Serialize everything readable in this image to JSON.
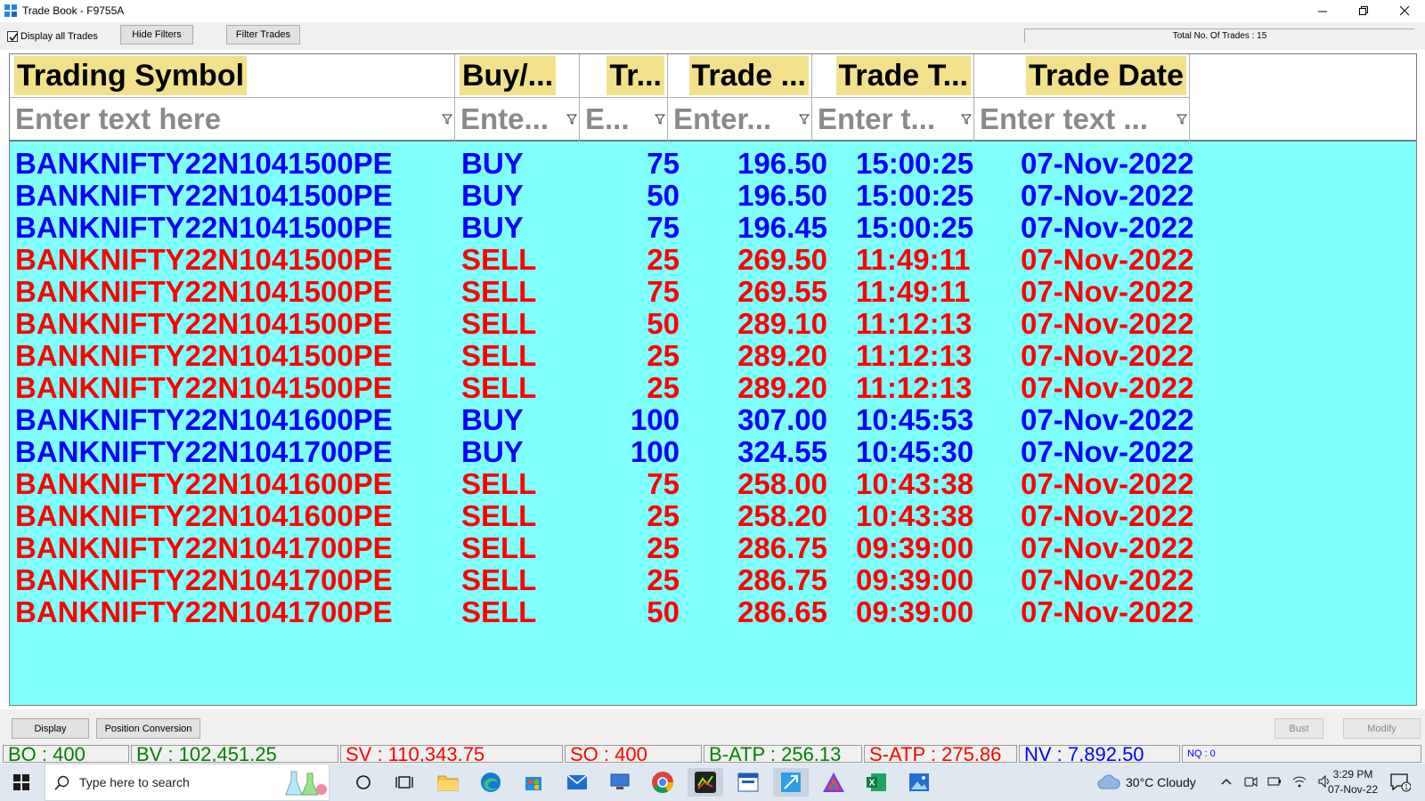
{
  "window": {
    "title": "Trade Book - F9755A"
  },
  "toolbar": {
    "display_all_label": "Display all Trades",
    "display_all_checked": true,
    "hide_filters_label": "Hide Filters",
    "filter_trades_label": "Filter Trades",
    "total_trades_text": "Total No. Of Trades : 15"
  },
  "grid": {
    "columns": [
      "Trading Symbol",
      "Buy/...",
      "Tr...",
      "Trade ...",
      "Trade T...",
      "Trade Date"
    ],
    "filters": [
      "Enter text here",
      "Ente...",
      "E...",
      "Enter...",
      "Enter t...",
      "Enter text ..."
    ],
    "colors": {
      "buy": "#0000ff",
      "sell": "#ff0000",
      "background": "#80ffff",
      "header_highlight": "#f2e18a"
    },
    "rows": [
      {
        "symbol": "BANKNIFTY22N1041500PE",
        "side": "BUY",
        "qty": "75",
        "price": "196.50",
        "time": "15:00:25",
        "date": "07-Nov-2022"
      },
      {
        "symbol": "BANKNIFTY22N1041500PE",
        "side": "BUY",
        "qty": "50",
        "price": "196.50",
        "time": "15:00:25",
        "date": "07-Nov-2022"
      },
      {
        "symbol": "BANKNIFTY22N1041500PE",
        "side": "BUY",
        "qty": "75",
        "price": "196.45",
        "time": "15:00:25",
        "date": "07-Nov-2022"
      },
      {
        "symbol": "BANKNIFTY22N1041500PE",
        "side": "SELL",
        "qty": "25",
        "price": "269.50",
        "time": "11:49:11",
        "date": "07-Nov-2022"
      },
      {
        "symbol": "BANKNIFTY22N1041500PE",
        "side": "SELL",
        "qty": "75",
        "price": "269.55",
        "time": "11:49:11",
        "date": "07-Nov-2022"
      },
      {
        "symbol": "BANKNIFTY22N1041500PE",
        "side": "SELL",
        "qty": "50",
        "price": "289.10",
        "time": "11:12:13",
        "date": "07-Nov-2022"
      },
      {
        "symbol": "BANKNIFTY22N1041500PE",
        "side": "SELL",
        "qty": "25",
        "price": "289.20",
        "time": "11:12:13",
        "date": "07-Nov-2022"
      },
      {
        "symbol": "BANKNIFTY22N1041500PE",
        "side": "SELL",
        "qty": "25",
        "price": "289.20",
        "time": "11:12:13",
        "date": "07-Nov-2022"
      },
      {
        "symbol": "BANKNIFTY22N1041600PE",
        "side": "BUY",
        "qty": "100",
        "price": "307.00",
        "time": "10:45:53",
        "date": "07-Nov-2022"
      },
      {
        "symbol": "BANKNIFTY22N1041700PE",
        "side": "BUY",
        "qty": "100",
        "price": "324.55",
        "time": "10:45:30",
        "date": "07-Nov-2022"
      },
      {
        "symbol": "BANKNIFTY22N1041600PE",
        "side": "SELL",
        "qty": "75",
        "price": "258.00",
        "time": "10:43:38",
        "date": "07-Nov-2022"
      },
      {
        "symbol": "BANKNIFTY22N1041600PE",
        "side": "SELL",
        "qty": "25",
        "price": "258.20",
        "time": "10:43:38",
        "date": "07-Nov-2022"
      },
      {
        "symbol": "BANKNIFTY22N1041700PE",
        "side": "SELL",
        "qty": "25",
        "price": "286.75",
        "time": "09:39:00",
        "date": "07-Nov-2022"
      },
      {
        "symbol": "BANKNIFTY22N1041700PE",
        "side": "SELL",
        "qty": "25",
        "price": "286.75",
        "time": "09:39:00",
        "date": "07-Nov-2022"
      },
      {
        "symbol": "BANKNIFTY22N1041700PE",
        "side": "SELL",
        "qty": "50",
        "price": "286.65",
        "time": "09:39:00",
        "date": "07-Nov-2022"
      }
    ]
  },
  "bottom": {
    "display_label": "Display",
    "position_conversion_label": "Position Conversion",
    "bust_label": "Bust",
    "modify_label": "Modify"
  },
  "status": [
    {
      "text": "BO : 400",
      "color": "#008000"
    },
    {
      "text": "BV : 102,451.25",
      "color": "#008000"
    },
    {
      "text": "SV : 110,343.75",
      "color": "#ff0000"
    },
    {
      "text": "SO : 400",
      "color": "#ff0000"
    },
    {
      "text": "B-ATP : 256.13",
      "color": "#008000"
    },
    {
      "text": "S-ATP : 275.86",
      "color": "#ff0000"
    },
    {
      "text": "NV : 7,892.50",
      "color": "#0000ff"
    },
    {
      "text": "NQ : 0",
      "color": "#0000ff"
    }
  ],
  "taskbar": {
    "search_placeholder": "Type here to search",
    "weather": "30°C  Cloudy",
    "time": "3:29 PM",
    "date": "07-Nov-22",
    "notification_count": "1"
  }
}
